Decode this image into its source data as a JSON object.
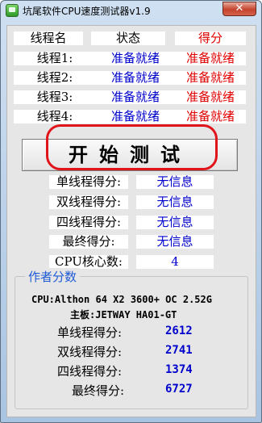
{
  "window": {
    "title": "坑尾软件CPU速度测试器v1.9",
    "close_glyph": "✕"
  },
  "table": {
    "headers": {
      "thread": "线程名",
      "status": "状态",
      "score": "得分"
    },
    "rows": [
      {
        "name": "线程1:",
        "status": "准备就绪",
        "score": "准备就绪"
      },
      {
        "name": "线程2:",
        "status": "准备就绪",
        "score": "准备就绪"
      },
      {
        "name": "线程3:",
        "status": "准备就绪",
        "score": "准备就绪"
      },
      {
        "name": "线程4:",
        "status": "准备就绪",
        "score": "准备就绪"
      }
    ]
  },
  "start_button": {
    "label": "开始测试"
  },
  "results": {
    "single_label": "单线程得分:",
    "single_value": "无信息",
    "dual_label": "双线程得分:",
    "dual_value": "无信息",
    "quad_label": "四线程得分:",
    "quad_value": "无信息",
    "final_label": "最终得分:",
    "final_value": "无信息",
    "cores_label": "CPU核心数:",
    "cores_value": "4"
  },
  "author": {
    "legend": "作者分数",
    "cpu": "CPU:Althon 64 X2 3600+ OC 2.52G",
    "board": "主板:JETWAY HA01-GT",
    "scores": [
      {
        "label": "单线程得分:",
        "value": "2612"
      },
      {
        "label": "双线程得分:",
        "value": "2741"
      },
      {
        "label": "四线程得分:",
        "value": "1374"
      },
      {
        "label": "最终得分:",
        "value": "6727"
      }
    ]
  },
  "colors": {
    "status_text": "#0000cc",
    "score_text": "#e00000",
    "highlight": "#e0141a",
    "legend": "#1f5bd6"
  }
}
